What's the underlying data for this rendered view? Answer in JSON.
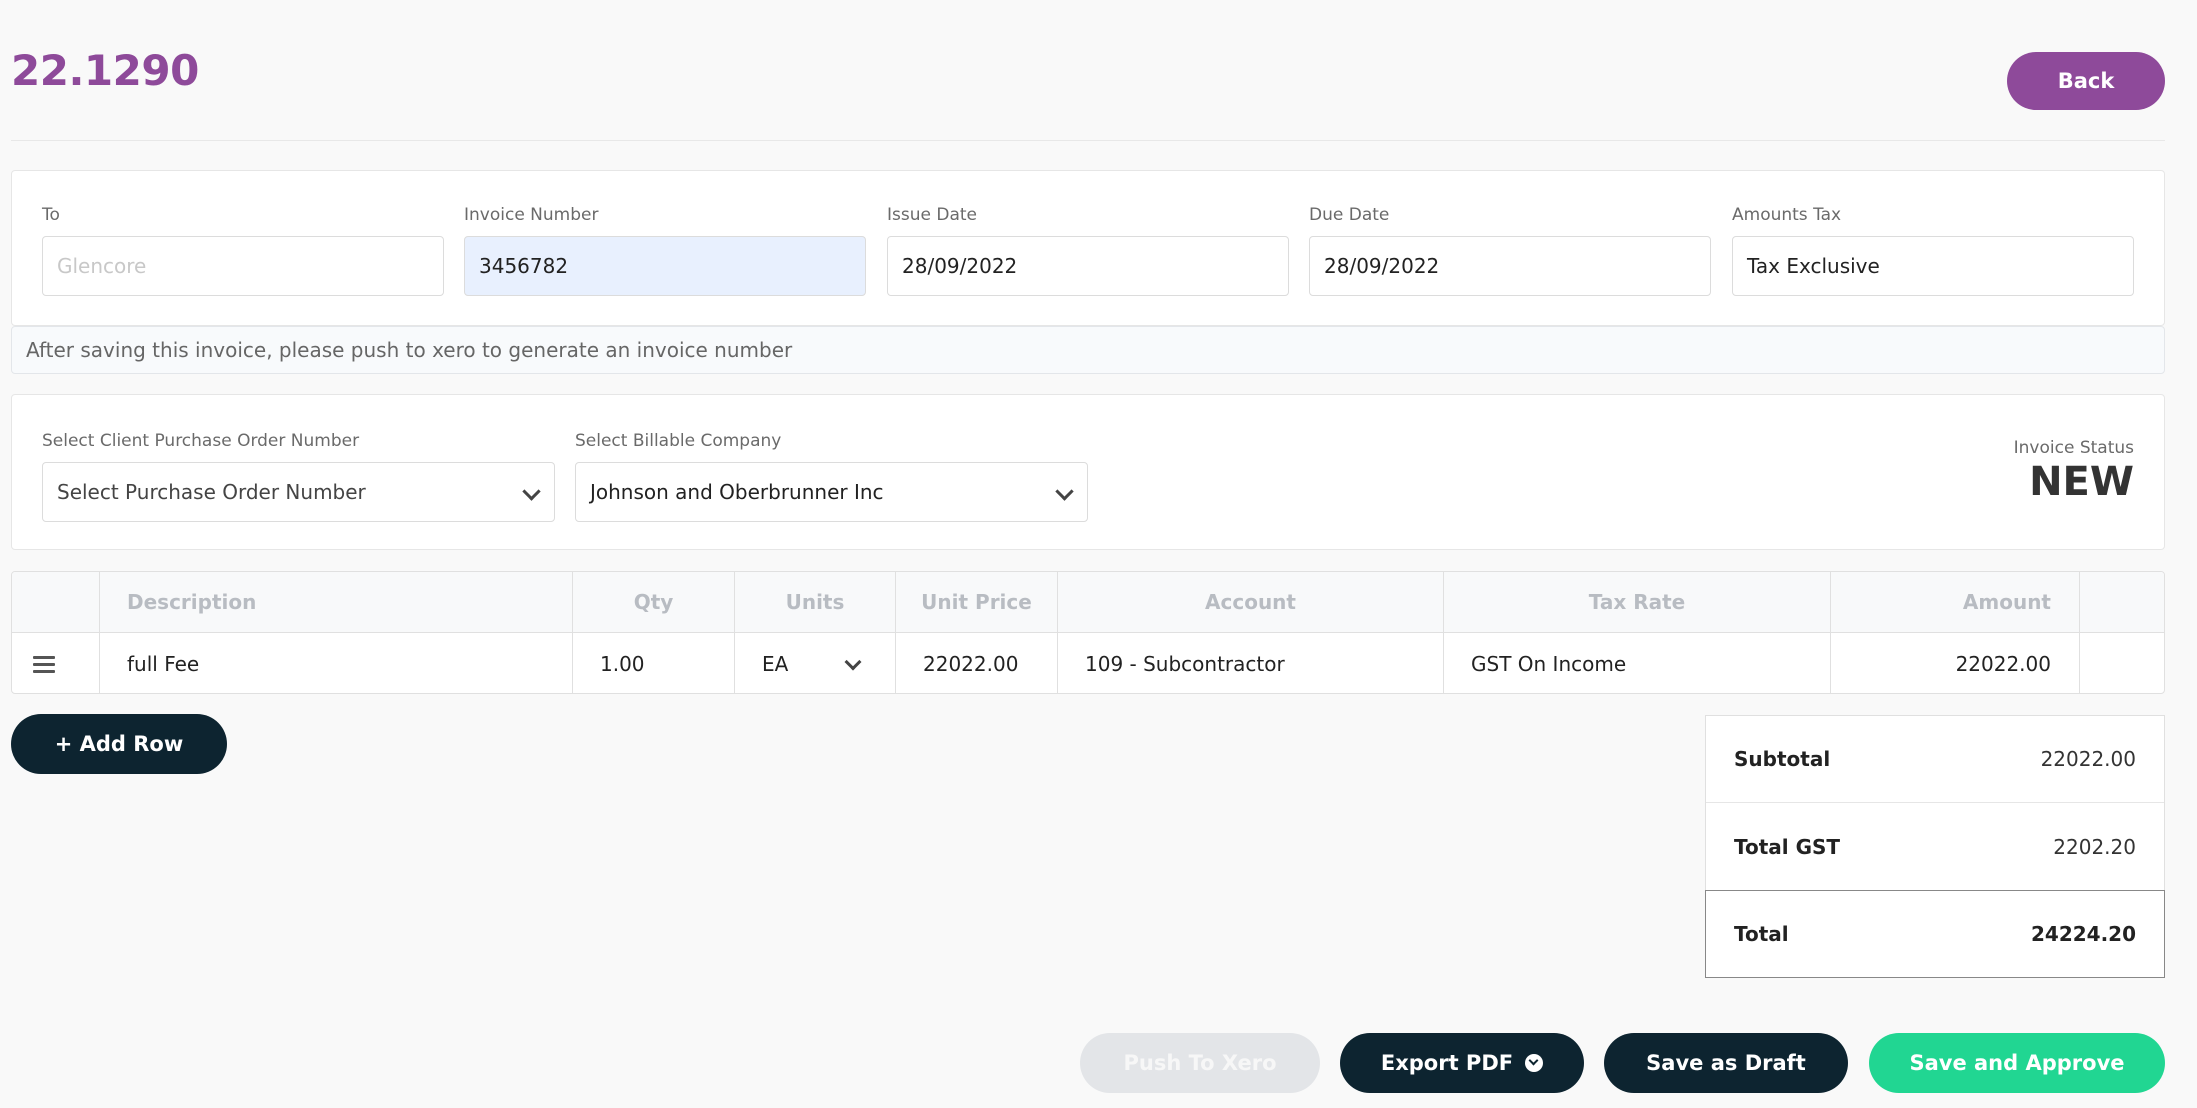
{
  "header": {
    "title": "22.1290",
    "back_label": "Back"
  },
  "invoice_fields": {
    "to": {
      "label": "To",
      "placeholder": "Glencore"
    },
    "invoice_number": {
      "label": "Invoice Number",
      "value": "3456782"
    },
    "issue_date": {
      "label": "Issue Date",
      "value": "28/09/2022"
    },
    "due_date": {
      "label": "Due Date",
      "value": "28/09/2022"
    },
    "amounts_tax": {
      "label": "Amounts Tax",
      "value": "Tax Exclusive"
    }
  },
  "notice": "After saving this invoice, please push to xero to generate an invoice number",
  "selectors": {
    "purchase_order": {
      "label": "Select Client Purchase Order Number",
      "value": "Select Purchase Order Number"
    },
    "billable_company": {
      "label": "Select Billable Company",
      "value": "Johnson and Oberbrunner Inc"
    }
  },
  "status": {
    "label": "Invoice Status",
    "value": "NEW"
  },
  "table": {
    "columns": {
      "description": "Description",
      "qty": "Qty",
      "units": "Units",
      "unit_price": "Unit Price",
      "account": "Account",
      "tax_rate": "Tax Rate",
      "amount": "Amount"
    },
    "rows": [
      {
        "description": "full Fee",
        "qty": "1.00",
        "units": "EA",
        "unit_price": "22022.00",
        "account": "109 - Subcontractor",
        "tax_rate": "GST On Income",
        "amount": "22022.00"
      }
    ]
  },
  "add_row_label": "+ Add Row",
  "totals": {
    "subtotal": {
      "label": "Subtotal",
      "value": "22022.00"
    },
    "gst": {
      "label": "Total GST",
      "value": "2202.20"
    },
    "total": {
      "label": "Total",
      "value": "24224.20"
    }
  },
  "actions": {
    "push_xero": "Push To Xero",
    "export_pdf": "Export PDF",
    "save_draft": "Save as Draft",
    "save_approve": "Save and Approve"
  },
  "colors": {
    "accent_purple": "#8e4a9a",
    "dark_button": "#0d2430",
    "green_button": "#21d692",
    "highlight_field": "#e8f0fe"
  }
}
